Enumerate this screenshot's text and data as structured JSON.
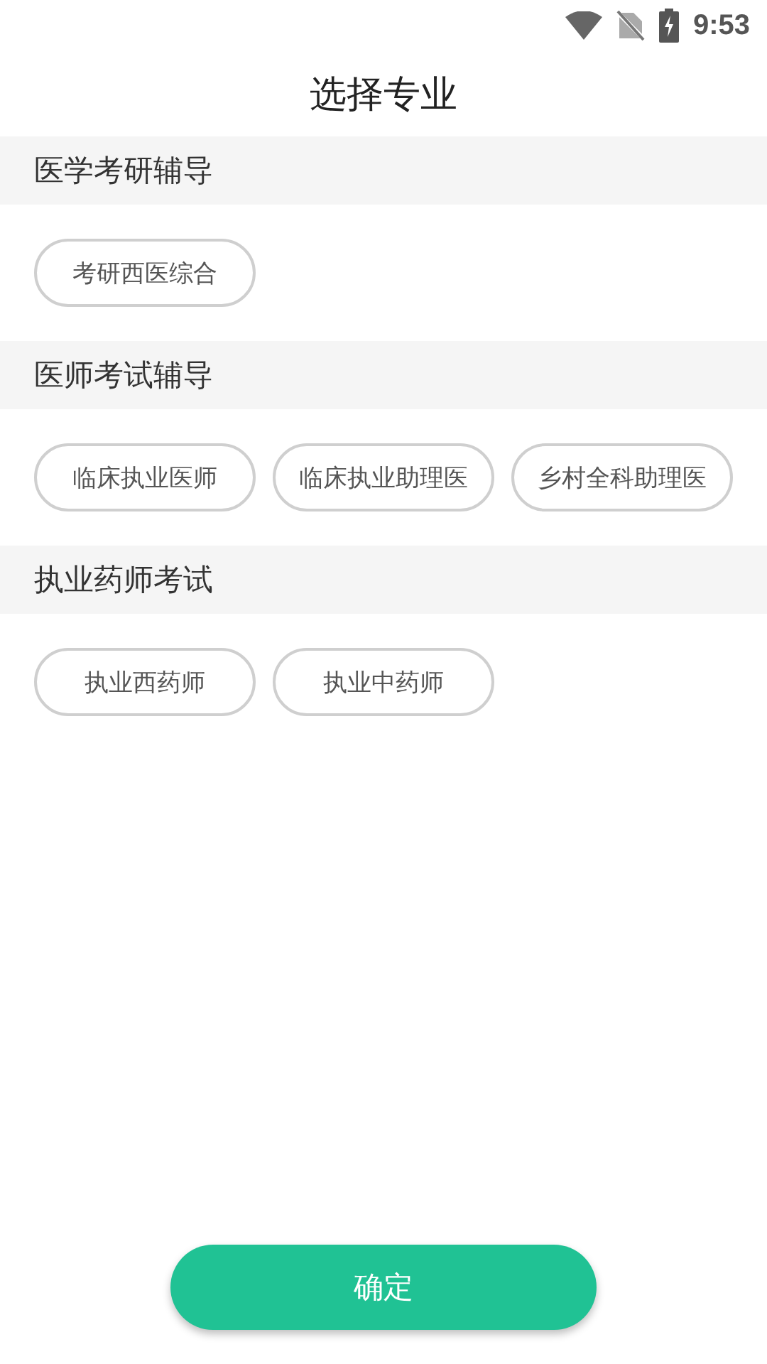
{
  "status_bar": {
    "time": "9:53"
  },
  "title": "选择专业",
  "sections": [
    {
      "heading": "医学考研辅导",
      "options": [
        "考研西医综合"
      ]
    },
    {
      "heading": "医师考试辅导",
      "options": [
        "临床执业医师",
        "临床执业助理医",
        "乡村全科助理医"
      ]
    },
    {
      "heading": "执业药师考试",
      "options": [
        "执业西药师",
        "执业中药师"
      ]
    }
  ],
  "confirm_button": "确定"
}
